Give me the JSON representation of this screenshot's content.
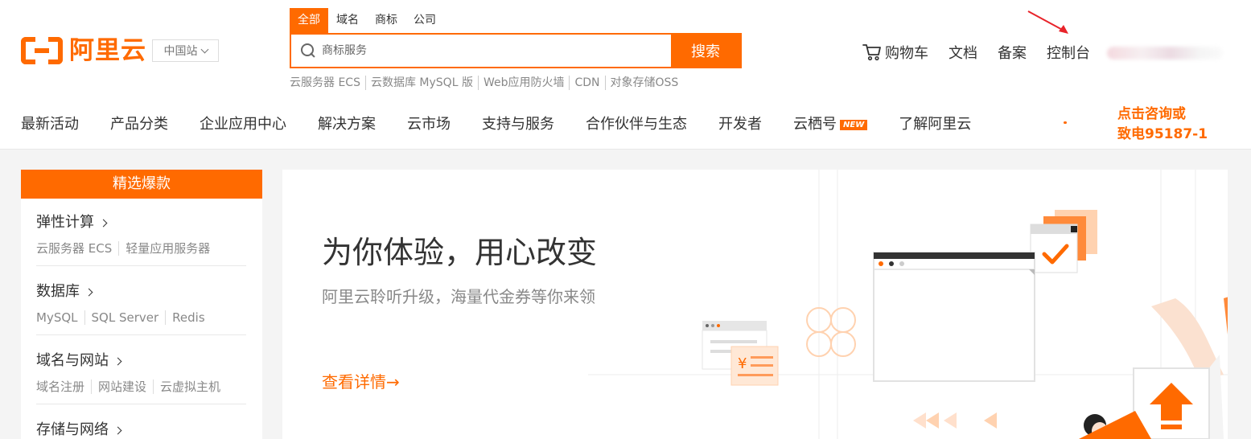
{
  "brand": {
    "logo_text": "阿里云",
    "region": "中国站"
  },
  "search": {
    "tabs": [
      {
        "label": "全部",
        "active": true
      },
      {
        "label": "域名",
        "active": false
      },
      {
        "label": "商标",
        "active": false
      },
      {
        "label": "公司",
        "active": false
      }
    ],
    "placeholder": "商标服务",
    "button_label": "搜索",
    "hot_links": [
      "云服务器 ECS",
      "云数据库 MySQL 版",
      "Web应用防火墙",
      "CDN",
      "对象存储OSS"
    ]
  },
  "top_nav": {
    "cart": "购物车",
    "docs": "文档",
    "filing": "备案",
    "console": "控制台"
  },
  "main_nav": [
    {
      "label": "最新活动"
    },
    {
      "label": "产品分类"
    },
    {
      "label": "企业应用中心"
    },
    {
      "label": "解决方案"
    },
    {
      "label": "云市场"
    },
    {
      "label": "支持与服务"
    },
    {
      "label": "合作伙伴与生态"
    },
    {
      "label": "开发者"
    },
    {
      "label": "云栖号",
      "badge": "NEW"
    },
    {
      "label": "了解阿里云"
    }
  ],
  "consult": {
    "line1": "点击咨询或",
    "line2": "致电95187-1"
  },
  "sidebar": {
    "title": "精选爆款",
    "categories": [
      {
        "title": "弹性计算",
        "links": [
          "云服务器 ECS",
          "轻量应用服务器"
        ]
      },
      {
        "title": "数据库",
        "links": [
          "MySQL",
          "SQL Server",
          "Redis"
        ]
      },
      {
        "title": "域名与网站",
        "links": [
          "域名注册",
          "网站建设",
          "云虚拟主机"
        ]
      },
      {
        "title": "存储与网络",
        "links": []
      }
    ]
  },
  "banner": {
    "title": "为你体验，用心改变",
    "subtitle": "阿里云聆听升级，海量代金券等你来领",
    "link": "查看详情→",
    "price_symbol": "¥"
  },
  "colors": {
    "accent": "#ff6a00",
    "text": "#333333",
    "muted": "#888888",
    "page_bg": "#f4f4f4"
  }
}
